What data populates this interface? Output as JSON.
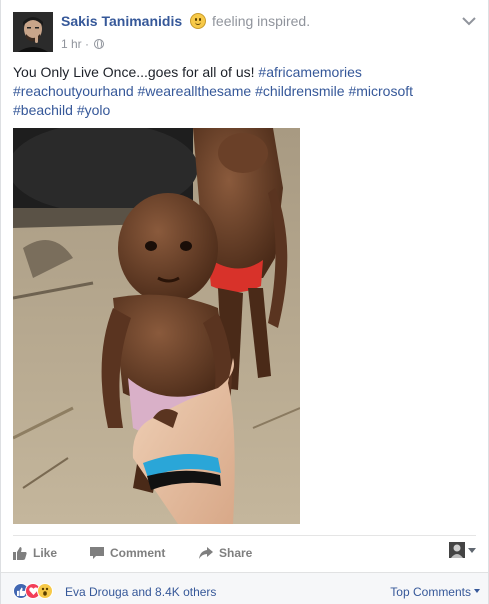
{
  "post": {
    "author": "Sakis Tanimanidis",
    "feeling": "feeling inspired.",
    "timestamp": "1 hr ·",
    "text_prefix": "You Only Live Once...goes for all of us!",
    "hashtags": [
      "#africamemories",
      "#reachoutyourhand",
      "#weareallthesame",
      "#childrensmile",
      "#microsoft",
      "#beachild",
      "#yolo"
    ]
  },
  "actions": {
    "like_label": "Like",
    "comment_label": "Comment",
    "share_label": "Share"
  },
  "reactions": {
    "types": [
      "like",
      "love",
      "wow"
    ],
    "summary": "Eva Drouga and 8.4K others",
    "top_comments_label": "Top Comments"
  },
  "colors": {
    "link": "#365899",
    "muted": "#90949c",
    "like_blue": "#4267b2",
    "love_red": "#f33e58",
    "wow_yellow": "#f7c948"
  }
}
